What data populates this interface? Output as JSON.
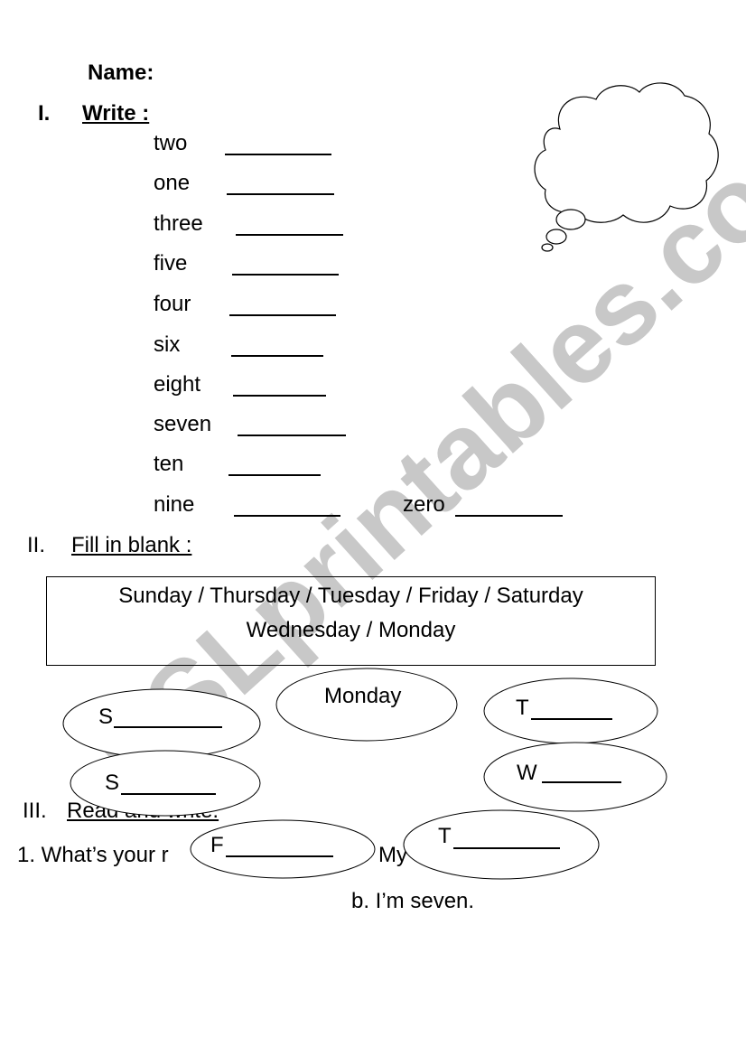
{
  "header": {
    "name_label": "Name:"
  },
  "section1": {
    "number": "I.",
    "title": "Write :",
    "words": [
      {
        "word": "two"
      },
      {
        "word": "one"
      },
      {
        "word": "three"
      },
      {
        "word": "five"
      },
      {
        "word": "four"
      },
      {
        "word": "six"
      },
      {
        "word": "eight"
      },
      {
        "word": "seven"
      },
      {
        "word": "ten"
      },
      {
        "word": "nine"
      }
    ],
    "extra_word": "zero"
  },
  "section2": {
    "number": "II.",
    "title": "Fill in blank :",
    "word_bank_line1": "Sunday / Thursday / Tuesday / Friday / Saturday",
    "word_bank_line2": "Wednesday / Monday",
    "ovals": [
      {
        "id": "s1",
        "letter": "S",
        "blank": true
      },
      {
        "id": "monday",
        "letter": "Monday",
        "blank": false
      },
      {
        "id": "t1",
        "letter": "T",
        "blank": true
      },
      {
        "id": "s2",
        "letter": "S",
        "blank": true
      },
      {
        "id": "w",
        "letter": "W",
        "blank": true
      },
      {
        "id": "f",
        "letter": "F",
        "blank": true
      },
      {
        "id": "t2",
        "letter": "T",
        "blank": true
      }
    ]
  },
  "section3": {
    "number": "III.",
    "title": "Read and write:",
    "visible_title": "Rea",
    "question1_prefix": "1. What’s your r",
    "question1_mid": "My",
    "answer_b": "b. I’m seven."
  },
  "watermark": {
    "text": "ESLprintables.com",
    "color": "#c8c8c8"
  },
  "thought_bubble": {
    "content": ""
  }
}
